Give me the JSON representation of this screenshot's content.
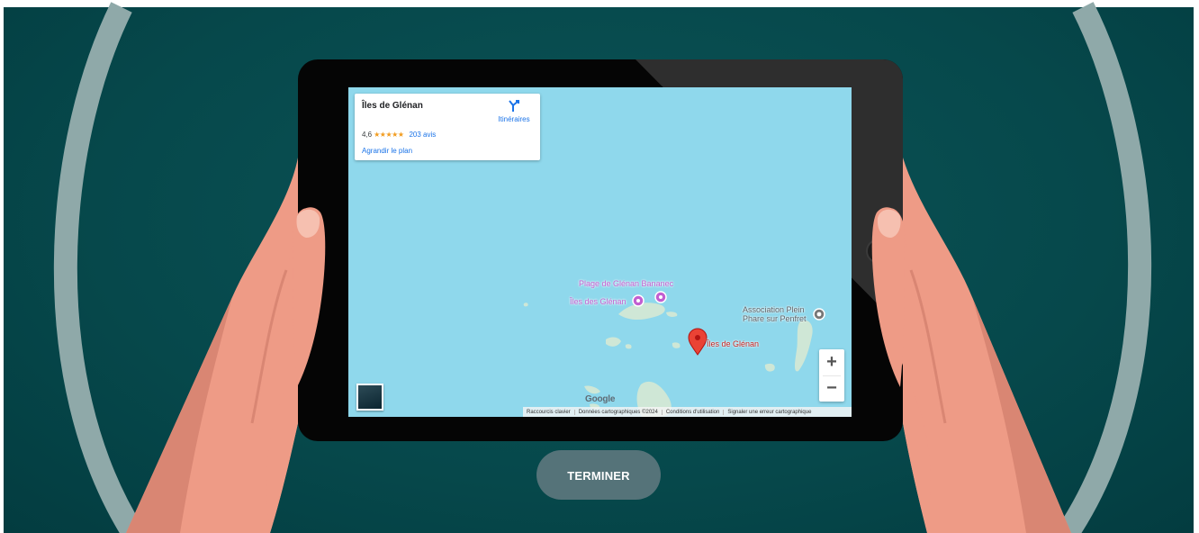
{
  "map": {
    "place_card": {
      "title": "Îles de Glénan",
      "rating": "4,6",
      "stars": "★★★★★",
      "reviews": "203 avis",
      "enlarge_label": "Agrandir le plan",
      "directions_label": "Itinéraires",
      "directions_icon": "directions-icon"
    },
    "labels": {
      "beach": "Plage de Glénan Bananec",
      "islands_poi": "Îles des Glénan",
      "association_line1": "Association Plein",
      "association_line2": "Phare sur Penfret",
      "marker_label": "Îles de Glénan"
    },
    "zoom": {
      "in_label": "+",
      "out_label": "−"
    },
    "google_logo": "Google",
    "footer": {
      "shortcuts": "Raccourcis clavier",
      "map_data": "Données cartographiques ©2024",
      "terms": "Conditions d'utilisation",
      "report": "Signaler une erreur cartographique"
    },
    "colors": {
      "water": "#8fd8ec",
      "land": "#cfe7d6",
      "marker": "#ea4335",
      "poi_purple": "#c25fd0"
    }
  },
  "actions": {
    "finish_label": "TERMINER"
  },
  "theme": {
    "background": "#06484b",
    "ring": "#8fa9a9",
    "skin": "#ee9b86",
    "button": "#557379"
  }
}
